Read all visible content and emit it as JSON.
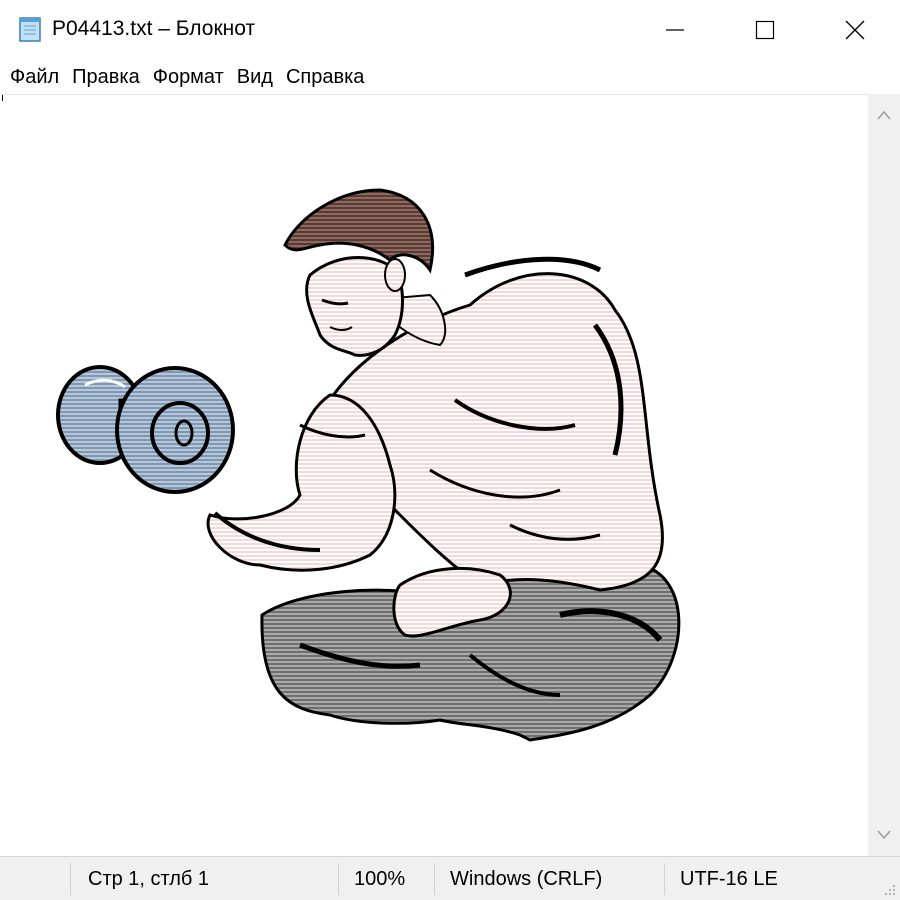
{
  "window": {
    "title": "P04413.txt – Блокнот",
    "icon": "notepad-icon",
    "controls": {
      "minimize": "minimize-icon",
      "maximize": "maximize-icon",
      "close": "close-icon"
    }
  },
  "menu": {
    "items": [
      {
        "label": "Файл"
      },
      {
        "label": "Правка"
      },
      {
        "label": "Формат"
      },
      {
        "label": "Вид"
      },
      {
        "label": "Справка"
      }
    ]
  },
  "editor": {
    "content_image": "bodybuilder-dumbbell-curl-clipart"
  },
  "status": {
    "position": "Стр 1, стлб 1",
    "zoom": "100%",
    "line_endings": "Windows (CRLF)",
    "encoding": "UTF-16 LE"
  },
  "colors": {
    "skin": "#f9e3e3",
    "hair": "#6b4a42",
    "pants": "#8a8a8a",
    "dumbbell": "#8fa7c2",
    "outline": "#000000",
    "statusbar_bg": "#f0f0f0"
  }
}
